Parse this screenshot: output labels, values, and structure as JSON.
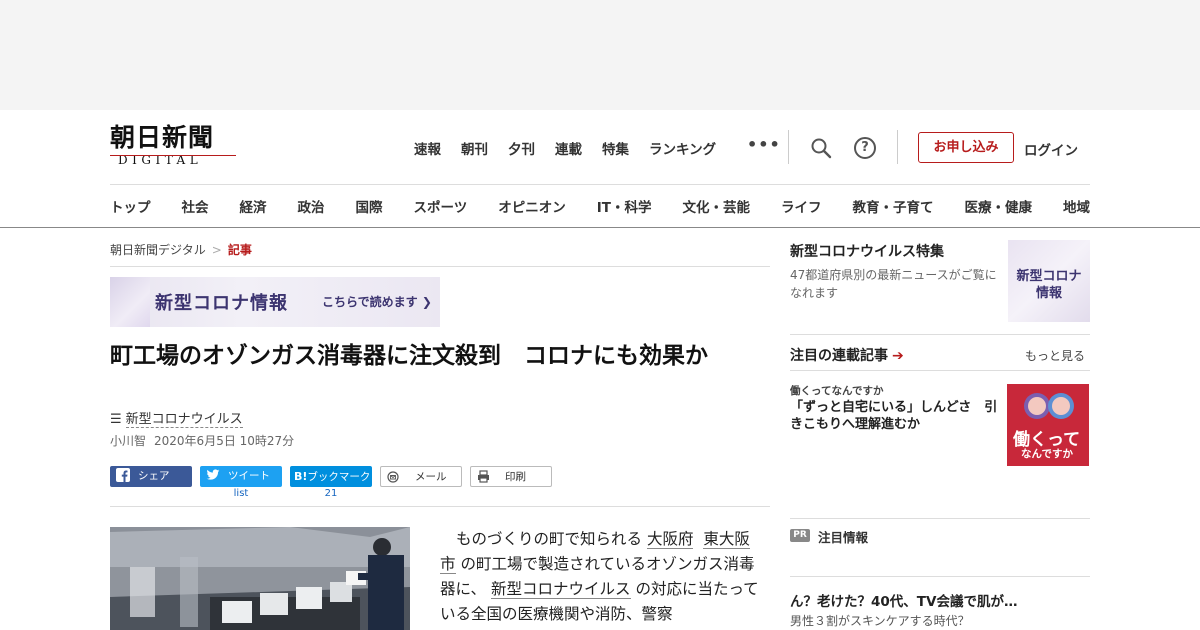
{
  "logo": {
    "kanji": "朝日新聞",
    "sub": "DIGITAL"
  },
  "topnav": [
    "速報",
    "朝刊",
    "夕刊",
    "連載",
    "特集",
    "ランキング"
  ],
  "more_dots": "•••",
  "help_glyph": "?",
  "apply_label": "お申し込み",
  "login_label": "ログイン",
  "categories": [
    "トップ",
    "社会",
    "経済",
    "政治",
    "国際",
    "スポーツ",
    "オピニオン",
    "IT・科学",
    "文化・芸能",
    "ライフ",
    "教育・子育て",
    "医療・健康",
    "地域"
  ],
  "breadcrumb": {
    "home": "朝日新聞デジタル",
    "sep": ">",
    "current": "記事"
  },
  "banner": {
    "title": "新型コロナ情報",
    "sub": "こちらで読めます"
  },
  "article": {
    "headline": "町工場のオゾンガス消毒器に注文殺到　コロナにも効果か",
    "tag": "新型コロナウイルス",
    "author": "小川智",
    "date": "2020年6月5日 10時27分",
    "body_1": "ものづくりの町で知られる",
    "body_link1": "大阪府",
    "body_link2": "東大阪市",
    "body_2": "の町工場で製造されているオゾンガス消毒器に、",
    "body_link3": "新型コロナウイルス",
    "body_3": "の対応に当たっている全国の医療機関や消防、警察"
  },
  "share": {
    "facebook": "シェア",
    "twitter": "ツイート",
    "twitter_count": "list",
    "hatena": "ブックマーク",
    "hatena_badge": "B!",
    "hatena_count": "21",
    "mail": "メール",
    "print": "印刷"
  },
  "sidebar": {
    "corona_title": "新型コロナウイルス特集",
    "corona_desc": "47都道府県別の最新ニュースがご覧になれます",
    "corona_thumb": "新型コロナ\n情報",
    "rensai_title": "注目の連載記事",
    "rensai_arrow": "➔",
    "rensai_more": "もっと見る",
    "rensai_series": "働くってなんですか",
    "rensai_headline": "「ずっと自宅にいる」しんどさ　引きこもりへ理解進むか",
    "rensai_thumb_main": "働くって",
    "rensai_thumb_sub": "なんですか",
    "pr_badge": "PR",
    "pr_label": "注目情報",
    "pr_title": "ん？老けた？40代、TV会議で肌が…",
    "pr_sub": "男性３割がスキンケアする時代？"
  },
  "colors": {
    "brand_red": "#b71c1c",
    "facebook": "#3b5998",
    "twitter": "#1da1f2",
    "hatena": "#008fde",
    "banner_text": "#3c3470"
  }
}
